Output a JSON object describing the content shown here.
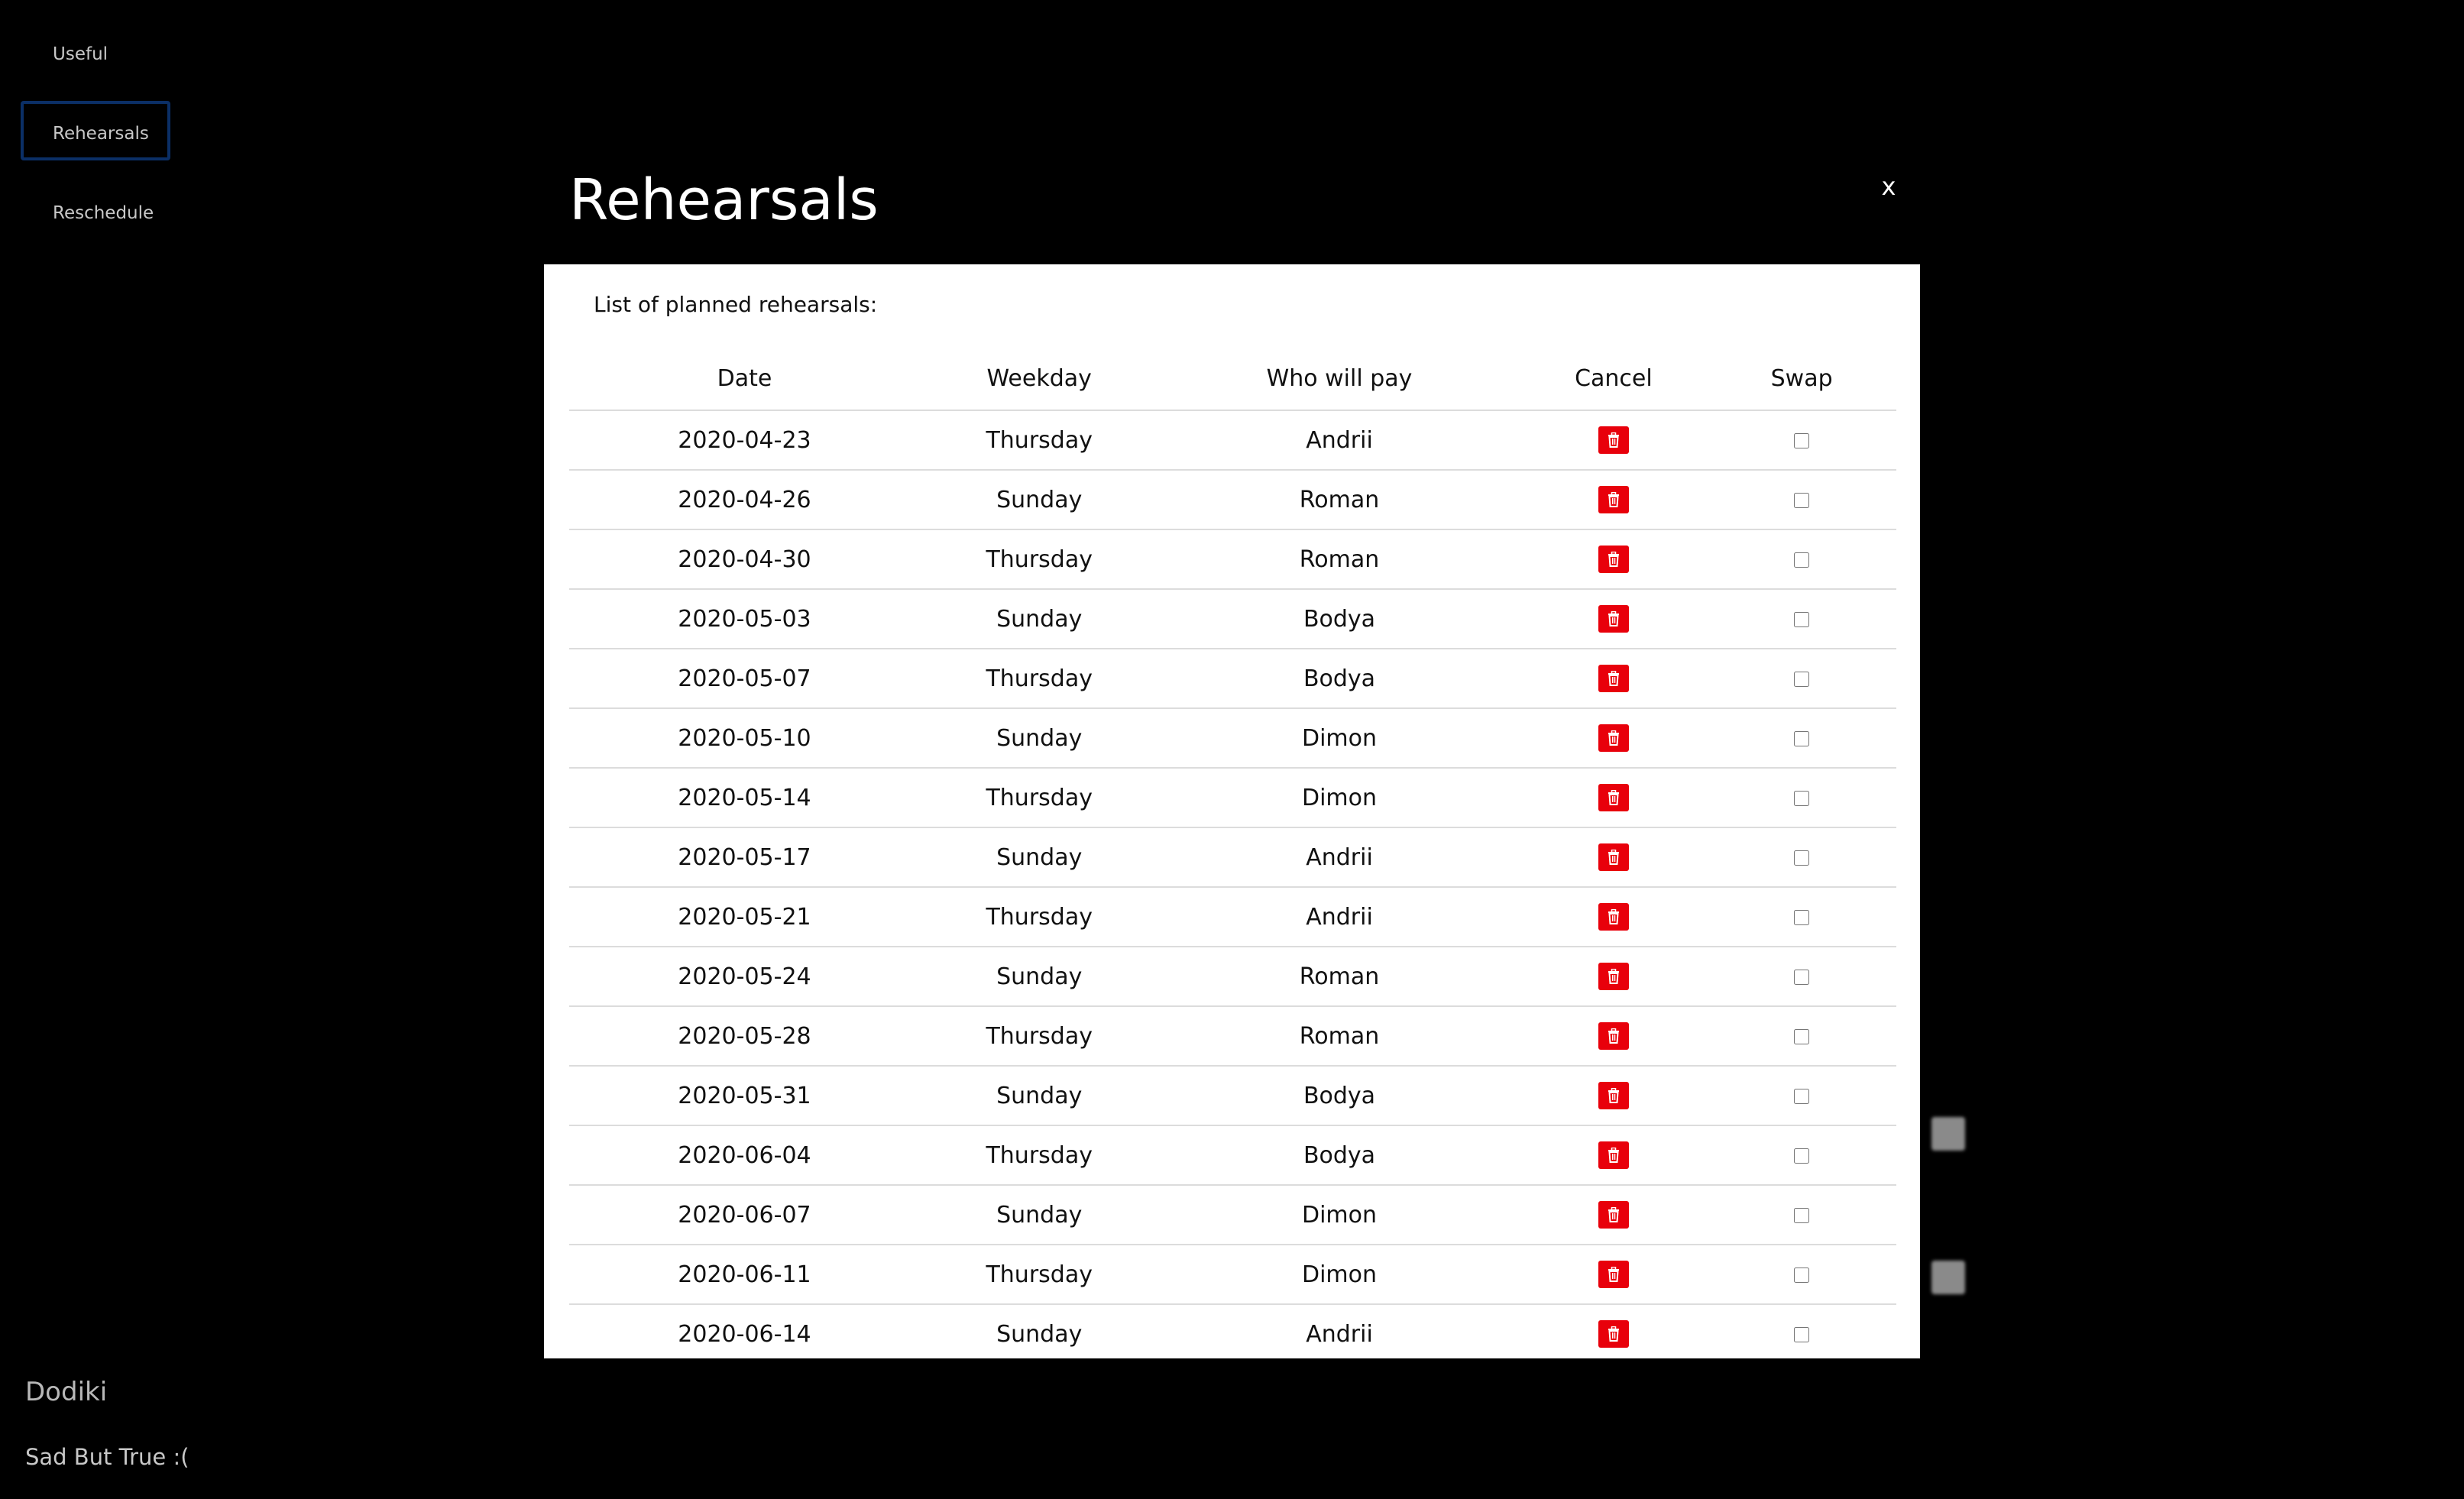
{
  "sidebar": {
    "items": [
      {
        "label": "Useful",
        "active": false
      },
      {
        "label": "Rehearsals",
        "active": true
      },
      {
        "label": "Reschedule",
        "active": false
      }
    ],
    "band_name": "Dodiki",
    "tagline": "Sad But True :("
  },
  "modal": {
    "title": "Rehearsals",
    "close_label": "x",
    "caption": "List of planned rehearsals:",
    "columns": {
      "date": "Date",
      "weekday": "Weekday",
      "payer": "Who will pay",
      "cancel": "Cancel",
      "swap": "Swap"
    },
    "rows": [
      {
        "date": "2020-04-23",
        "weekday": "Thursday",
        "payer": "Andrii",
        "swap": false
      },
      {
        "date": "2020-04-26",
        "weekday": "Sunday",
        "payer": "Roman",
        "swap": false
      },
      {
        "date": "2020-04-30",
        "weekday": "Thursday",
        "payer": "Roman",
        "swap": false
      },
      {
        "date": "2020-05-03",
        "weekday": "Sunday",
        "payer": "Bodya",
        "swap": false
      },
      {
        "date": "2020-05-07",
        "weekday": "Thursday",
        "payer": "Bodya",
        "swap": false
      },
      {
        "date": "2020-05-10",
        "weekday": "Sunday",
        "payer": "Dimon",
        "swap": false
      },
      {
        "date": "2020-05-14",
        "weekday": "Thursday",
        "payer": "Dimon",
        "swap": false
      },
      {
        "date": "2020-05-17",
        "weekday": "Sunday",
        "payer": "Andrii",
        "swap": false
      },
      {
        "date": "2020-05-21",
        "weekday": "Thursday",
        "payer": "Andrii",
        "swap": false
      },
      {
        "date": "2020-05-24",
        "weekday": "Sunday",
        "payer": "Roman",
        "swap": false
      },
      {
        "date": "2020-05-28",
        "weekday": "Thursday",
        "payer": "Roman",
        "swap": false
      },
      {
        "date": "2020-05-31",
        "weekday": "Sunday",
        "payer": "Bodya",
        "swap": false
      },
      {
        "date": "2020-06-04",
        "weekday": "Thursday",
        "payer": "Bodya",
        "swap": false
      },
      {
        "date": "2020-06-07",
        "weekday": "Sunday",
        "payer": "Dimon",
        "swap": false
      },
      {
        "date": "2020-06-11",
        "weekday": "Thursday",
        "payer": "Dimon",
        "swap": false
      },
      {
        "date": "2020-06-14",
        "weekday": "Sunday",
        "payer": "Andrii",
        "swap": false
      }
    ],
    "cancel_icon": "trash-icon",
    "cancel_color": "#e8000b"
  },
  "colors": {
    "background": "#000000",
    "active_nav_border": "#0b2f66",
    "modal_body": "#ffffff"
  }
}
